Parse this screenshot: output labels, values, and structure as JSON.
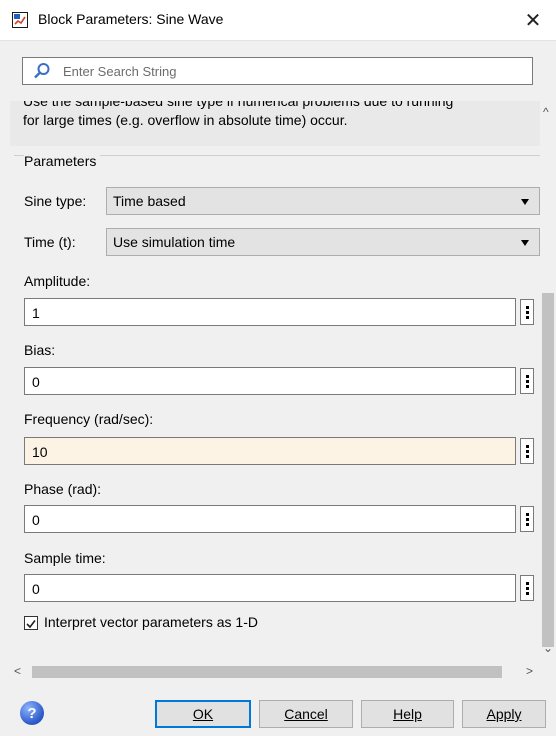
{
  "window": {
    "title": "Block Parameters: Sine Wave"
  },
  "search": {
    "placeholder": "Enter Search String"
  },
  "description": {
    "line1": "Use the sample-based sine type if numerical problems due to running",
    "line2": "for large times (e.g. overflow in absolute time) occur."
  },
  "parameters": {
    "group_title": "Parameters",
    "sine_type": {
      "label": "Sine type:",
      "value": "Time based"
    },
    "time": {
      "label": "Time (t):",
      "value": "Use simulation time"
    },
    "amplitude": {
      "label": "Amplitude:",
      "value": "1"
    },
    "bias": {
      "label": "Bias:",
      "value": "0"
    },
    "frequency": {
      "label": "Frequency (rad/sec):",
      "value": "10"
    },
    "phase": {
      "label": "Phase (rad):",
      "value": "0"
    },
    "sample_time": {
      "label": "Sample time:",
      "value": "0"
    },
    "interpret_vector": {
      "label": "Interpret vector parameters as 1-D",
      "checked": true
    }
  },
  "buttons": {
    "ok": "OK",
    "cancel": "Cancel",
    "help": "Help",
    "apply": "Apply"
  },
  "colors": {
    "active_field": "#fdf3e4",
    "default_button_border": "#0078d7"
  },
  "icons": {
    "app": "simulink-block-icon",
    "close": "close-icon",
    "search": "search-icon",
    "help": "help-icon",
    "dropdown": "chevron-down-icon",
    "more": "vertical-dots-icon"
  }
}
